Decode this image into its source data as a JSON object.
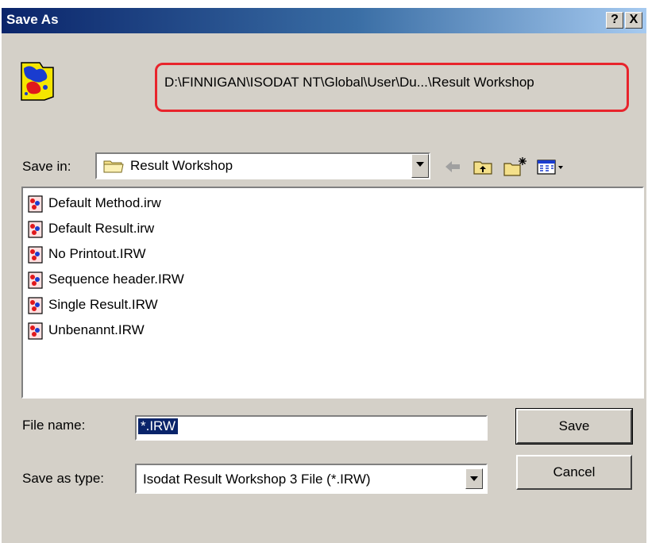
{
  "window": {
    "title": "Save As",
    "help_button": "?",
    "close_button": "X"
  },
  "header": {
    "path": "D:\\FINNIGAN\\ISODAT NT\\Global\\User\\Du...\\Result Workshop",
    "highlight_color": "#e8242c"
  },
  "save_in": {
    "label": "Save in:",
    "value": "Result Workshop"
  },
  "toolbar": {
    "icons": [
      "back-arrow-icon",
      "up-folder-icon",
      "new-folder-icon",
      "view-menu-icon"
    ]
  },
  "files": [
    {
      "name": "Default Method.irw"
    },
    {
      "name": "Default Result.irw"
    },
    {
      "name": "No Printout.IRW"
    },
    {
      "name": "Sequence header.IRW"
    },
    {
      "name": "Single Result.IRW"
    },
    {
      "name": "Unbenannt.IRW"
    }
  ],
  "file_name": {
    "label": "File name:",
    "value": "*.IRW"
  },
  "save_as_type": {
    "label": "Save as type:",
    "value": "Isodat Result Workshop 3  File (*.IRW)"
  },
  "buttons": {
    "save": "Save",
    "cancel": "Cancel"
  },
  "colors": {
    "title_gradient_start": "#0a246a",
    "title_gradient_end": "#a6caf0",
    "dialog_face": "#d4d0c8",
    "selection": "#0a246a"
  }
}
